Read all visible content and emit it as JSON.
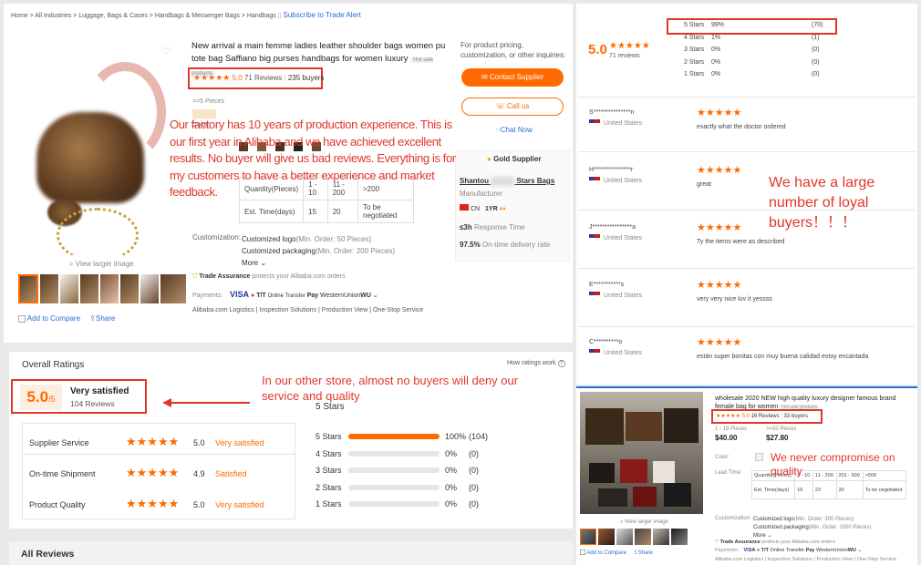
{
  "breadcrumb": {
    "items": [
      "Home",
      "All Industries",
      "Luggage, Bags & Cases",
      "Handbags & Messenger Bags",
      "Handbags"
    ],
    "subscribe": "Subscribe to Trade Alert"
  },
  "product": {
    "title": "New arrival a main femme ladies leather shoulder bags women pu tote bag Saffiano big purses handbags for women luxury",
    "badge": "Hot sale products",
    "stars": "★★★★★",
    "rating": "5.0",
    "reviews": "71 Reviews",
    "buyers": "235 buyers",
    "min_pieces": ">=5 Pieces",
    "color_label": "Color:",
    "view_larger": "View larger image",
    "add_compare": "Add to Compare",
    "share": "Share",
    "lead_time": {
      "headers": [
        "Quantity(Pieces)",
        "1 - 10",
        "11 - 200",
        ">200"
      ],
      "row_label": "Est. Time(days)",
      "values": [
        "15",
        "20",
        "To be negotiated"
      ]
    },
    "customization_label": "Customization:",
    "customization": [
      {
        "name": "Customized logo",
        "note": "(Min. Order: 50 Pieces)"
      },
      {
        "name": "Customized packaging",
        "note": "(Min. Order: 200 Pieces)"
      }
    ],
    "more": "More",
    "trade_assurance": "Trade Assurance",
    "trade_note": "protects your Alibaba.com orders",
    "payments_label": "Payments:",
    "payments": [
      "VISA",
      "T/T",
      "Online Transfer",
      "Pay",
      "WesternUnion",
      "WU"
    ],
    "services": [
      "Alibaba.com Logistics",
      "Inspection Solutions",
      "Production View",
      "One-Stop Service"
    ]
  },
  "supplier": {
    "inquiry": "For product pricing, customization, or other inquiries:",
    "contact": "Contact Supplier",
    "call": "Call us",
    "chat": "Chat Now",
    "gold": "Gold Supplier",
    "name_left": "Shantou",
    "name_right": "Stars Bags",
    "type": "Manufacturer",
    "country": "CN",
    "years": "1YR",
    "response_value": "≤3h",
    "response_label": "Response Time",
    "delivery_value": "97.5%",
    "delivery_label": "On-time delivery rate"
  },
  "annotations": {
    "factory": "Our factory has 10 years of production experience. This is our first year in Alibaba and we have achieved excellent results. No buyer will give us bad reviews. Everything is for my customers to have a better experience and market feedback.",
    "loyal": "We have a large number of loyal buyers！！！",
    "other_store": "In our other store, almost no buyers will deny our service and quality",
    "quality": "We never compromise on quality"
  },
  "overall": {
    "title": "Overall Ratings",
    "how": "How ratings work",
    "score": "5.0",
    "out_of": "/5",
    "verdict": "Very satisfied",
    "reviews": "104 Reviews",
    "metrics": [
      {
        "label": "Supplier Service",
        "stars": "★★★★★",
        "value": "5.0",
        "verdict": "Very satisfied"
      },
      {
        "label": "On-time Shipment",
        "stars": "★★★★★",
        "value": "4.9",
        "verdict": "Satisfied"
      },
      {
        "label": "Product Quality",
        "stars": "★★★★★",
        "value": "5.0",
        "verdict": "Very satisfied"
      }
    ],
    "breakdown_title": "5 Stars",
    "breakdown": [
      {
        "label": "5 Stars",
        "pct": "100%",
        "count": "(104)",
        "fill": 1.0
      },
      {
        "label": "4 Stars",
        "pct": "0%",
        "count": "(0)",
        "fill": 0
      },
      {
        "label": "3 Stars",
        "pct": "0%",
        "count": "(0)",
        "fill": 0
      },
      {
        "label": "2 Stars",
        "pct": "0%",
        "count": "(0)",
        "fill": 0
      },
      {
        "label": "1 Stars",
        "pct": "0%",
        "count": "(0)",
        "fill": 0
      }
    ],
    "all_reviews": "All Reviews"
  },
  "right_summary": {
    "score": "5.0",
    "stars": "★★★★★",
    "reviews": "71 reviews",
    "breakdown": [
      {
        "label": "5 Stars",
        "pct": "99%",
        "count": "(70)"
      },
      {
        "label": "4 Stars",
        "pct": "1%",
        "count": "(1)"
      },
      {
        "label": "3 Stars",
        "pct": "0%",
        "count": "(0)"
      },
      {
        "label": "2 Stars",
        "pct": "0%",
        "count": "(0)"
      },
      {
        "label": "1 Stars",
        "pct": "0%",
        "count": "(0)"
      }
    ]
  },
  "reviews": [
    {
      "user": "S***************n",
      "country": "United States",
      "stars": "★★★★★",
      "text": "exactly what the doctor ordered"
    },
    {
      "user": "H***************r",
      "country": "United States",
      "stars": "★★★★★",
      "text": "great"
    },
    {
      "user": "J****************a",
      "country": "United States",
      "stars": "★★★★★",
      "text": "Ty the items were as described"
    },
    {
      "user": "E***********s",
      "country": "United States",
      "stars": "★★★★★",
      "text": "very very nice luv it yessss"
    },
    {
      "user": "C**********o",
      "country": "United States",
      "stars": "★★★★★",
      "text": "están super bonitas con muy buena calidad estoy encantada"
    }
  ],
  "product2": {
    "title": "wholesale 2020 NEW high quality luxury designer famous brand female bag for women",
    "badge": "Hot sale products",
    "stars": "★★★★★",
    "rating": "5.0",
    "reviews": "16 Reviews",
    "buyers": "33 buyers",
    "price1_label": "1 - 19 Pieces",
    "price1": "$40.00",
    "price2_label": ">=20 Pieces",
    "price2": "$27.80",
    "color_label": "Color:",
    "lead_label": "Lead Time:",
    "lead_headers": [
      "Quantity(Pieces)",
      "1 - 10",
      "11 - 200",
      "201 - 500",
      ">500"
    ],
    "lead_row_label": "Est. Time(days)",
    "lead_values": [
      "15",
      "23",
      "30",
      "To be negotiated"
    ],
    "customization_label": "Customization:",
    "customization": [
      {
        "name": "Customized logo",
        "note": "(Min. Order: 300 Pieces)"
      },
      {
        "name": "Customized packaging",
        "note": "(Min. Order: 1000 Pieces)"
      }
    ],
    "more": "More",
    "view_larger": "View larger image",
    "add_compare": "Add to Compare",
    "share": "Share",
    "trade_assurance": "Trade Assurance",
    "trade_note": "protects your Alibaba.com orders",
    "payments_label": "Payments:",
    "payments": [
      "VISA",
      "T/T",
      "Online Transfer",
      "Pay",
      "WesternUnion",
      "WU"
    ],
    "services": [
      "Alibaba.com Logistics",
      "Inspection Solutions",
      "Production View",
      "One-Stop Service"
    ]
  }
}
